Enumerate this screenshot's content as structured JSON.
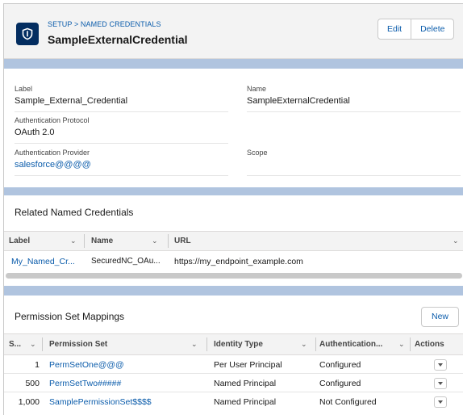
{
  "header": {
    "breadcrumb": "SETUP > NAMED CREDENTIALS",
    "title": "SampleExternalCredential",
    "edit_label": "Edit",
    "delete_label": "Delete",
    "icon": "shield-icon"
  },
  "details": {
    "label_label": "Label",
    "label_value": "Sample_External_Credential",
    "name_label": "Name",
    "name_value": "SampleExternalCredential",
    "auth_protocol_label": "Authentication Protocol",
    "auth_protocol_value": "OAuth 2.0",
    "auth_provider_label": "Authentication Provider",
    "auth_provider_value": "salesforce@@@@",
    "scope_label": "Scope",
    "scope_value": ""
  },
  "related_named_credentials": {
    "title": "Related Named Credentials",
    "columns": [
      "Label",
      "Name",
      "URL"
    ],
    "rows": [
      {
        "label": "My_Named_Cr...",
        "name": "SecuredNC_OAu...",
        "url": "https://my_endpoint_example.com"
      }
    ]
  },
  "permission_set_mappings": {
    "title": "Permission Set Mappings",
    "new_label": "New",
    "columns": [
      "S...",
      "Permission Set",
      "Identity Type",
      "Authentication...",
      "Actions"
    ],
    "rows": [
      {
        "seq": "1",
        "permission_set": "PermSetOne@@@",
        "identity_type": "Per User Principal",
        "authentication": "Configured"
      },
      {
        "seq": "500",
        "permission_set": "PermSetTwo#####",
        "identity_type": "Named Principal",
        "authentication": "Configured"
      },
      {
        "seq": "1,000",
        "permission_set": "SamplePermissionSet$$$$",
        "identity_type": "Named Principal",
        "authentication": "Not Configured"
      }
    ]
  },
  "colors": {
    "brand_link": "#0b5cab",
    "icon_bg": "#032d60",
    "band": "#b0c4df",
    "header_bg": "#f3f3f3"
  }
}
